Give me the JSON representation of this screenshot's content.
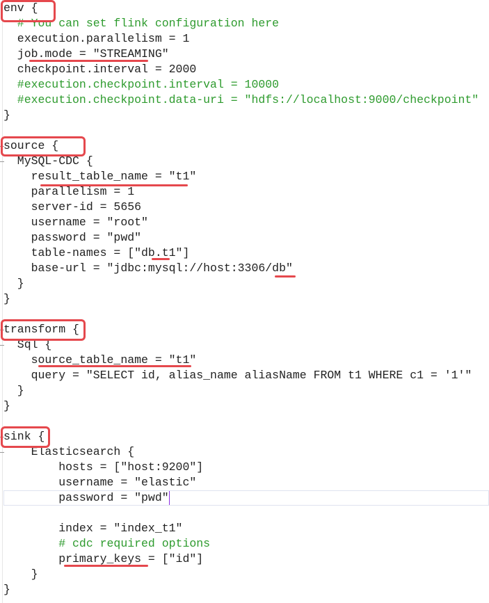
{
  "editor": {
    "accent_annotation_color": "#e5484d",
    "comment_color": "#2e9b2e",
    "lines": [
      {
        "text": "env {",
        "type": "code"
      },
      {
        "text": "  # You can set flink configuration here",
        "type": "comment"
      },
      {
        "text": "  execution.parallelism = 1",
        "type": "code"
      },
      {
        "text": "  job.mode = \"STREAMING\"",
        "type": "code"
      },
      {
        "text": "  checkpoint.interval = 2000",
        "type": "code"
      },
      {
        "text": "  #execution.checkpoint.interval = 10000",
        "type": "comment"
      },
      {
        "text": "  #execution.checkpoint.data-uri = \"hdfs://localhost:9000/checkpoint\"",
        "type": "comment"
      },
      {
        "text": "}",
        "type": "code"
      },
      {
        "text": "",
        "type": "code"
      },
      {
        "text": "source {",
        "type": "code"
      },
      {
        "text": "  MySQL-CDC {",
        "type": "code"
      },
      {
        "text": "    result_table_name = \"t1\"",
        "type": "code"
      },
      {
        "text": "    parallelism = 1",
        "type": "code"
      },
      {
        "text": "    server-id = 5656",
        "type": "code"
      },
      {
        "text": "    username = \"root\"",
        "type": "code"
      },
      {
        "text": "    password = \"pwd\"",
        "type": "code"
      },
      {
        "text": "    table-names = [\"db.t1\"]",
        "type": "code"
      },
      {
        "text": "    base-url = \"jdbc:mysql://host:3306/db\"",
        "type": "code"
      },
      {
        "text": "  }",
        "type": "code"
      },
      {
        "text": "}",
        "type": "code"
      },
      {
        "text": "",
        "type": "code"
      },
      {
        "text": "transform {",
        "type": "code"
      },
      {
        "text": "  Sql {",
        "type": "code"
      },
      {
        "text": "    source_table_name = \"t1\"",
        "type": "code"
      },
      {
        "text": "    query = \"SELECT id, alias_name aliasName FROM t1 WHERE c1 = '1'\"",
        "type": "code"
      },
      {
        "text": "  }",
        "type": "code"
      },
      {
        "text": "}",
        "type": "code"
      },
      {
        "text": "",
        "type": "code"
      },
      {
        "text": "sink {",
        "type": "code"
      },
      {
        "text": "    Elasticsearch {",
        "type": "code"
      },
      {
        "text": "        hosts = [\"host:9200\"]",
        "type": "code"
      },
      {
        "text": "        username = \"elastic\"",
        "type": "code"
      },
      {
        "text": "        password = \"pwd\"",
        "type": "current"
      },
      {
        "text": "",
        "type": "code"
      },
      {
        "text": "        index = \"index_t1\"",
        "type": "code"
      },
      {
        "text": "        # cdc required options",
        "type": "comment"
      },
      {
        "text": "        primary_keys = [\"id\"]",
        "type": "code"
      },
      {
        "text": "    }",
        "type": "code"
      },
      {
        "text": "}",
        "type": "code"
      }
    ]
  }
}
